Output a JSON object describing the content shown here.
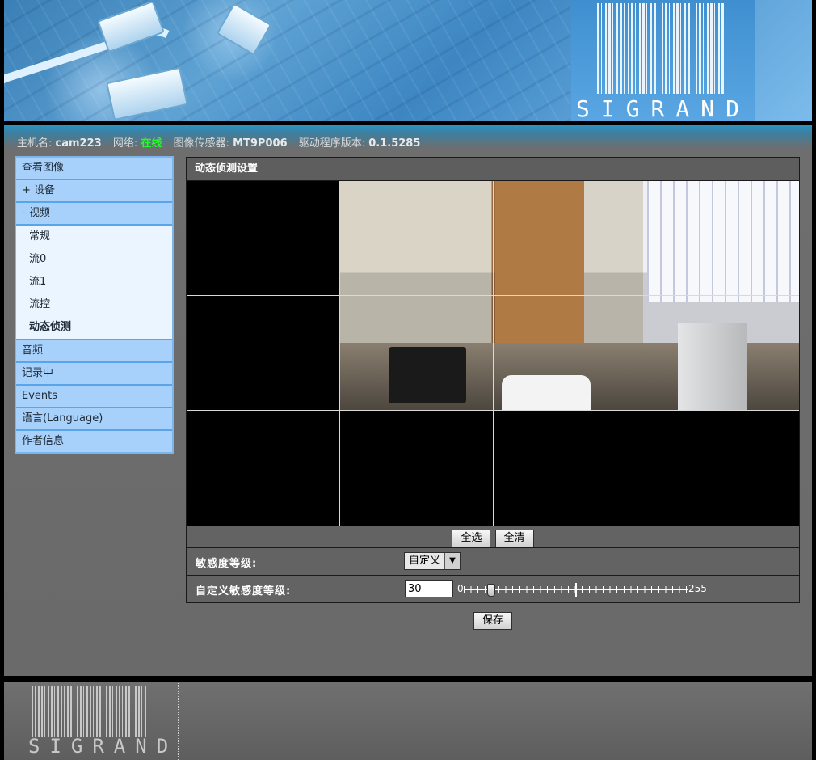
{
  "brand": {
    "logo_text": "SIGRAND"
  },
  "info": {
    "hostname_label": "主机名:",
    "hostname": "cam223",
    "network_label": "网络:",
    "network_status": "在线",
    "sensor_label": "图像传感器:",
    "sensor": "MT9P006",
    "driver_label": "驱动程序版本:",
    "driver_version": "0.1.5285",
    "colors": {
      "online": "#22ff22"
    }
  },
  "sidebar": {
    "items": [
      {
        "label": "查看图像"
      },
      {
        "label": "+ 设备"
      },
      {
        "label": "- 视频"
      },
      {
        "label": "音频"
      },
      {
        "label": "记录中"
      },
      {
        "label": "Events"
      },
      {
        "label": "语言(Language)"
      },
      {
        "label": "作者信息"
      }
    ],
    "video_sub": [
      {
        "label": "常规"
      },
      {
        "label": "流0"
      },
      {
        "label": "流1"
      },
      {
        "label": "流控"
      },
      {
        "label": "动态侦测"
      }
    ]
  },
  "panel": {
    "title": "动态侦测设置",
    "select_all": "全选",
    "clear_all": "全清",
    "sensitivity_label": "敏感度等级:",
    "sensitivity_value": "自定义",
    "custom_label": "自定义敏感度等级:",
    "custom_value": "30",
    "slider": {
      "min": "0",
      "max": "255",
      "value": 30
    },
    "save": "保存"
  }
}
